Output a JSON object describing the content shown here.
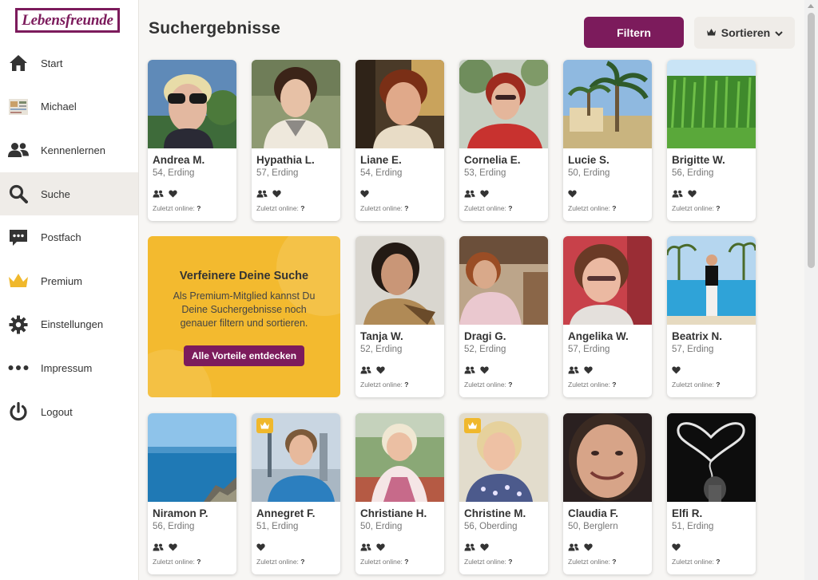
{
  "app": {
    "logo_text": "Lebensfreunde",
    "brand_color": "#7c1b5c",
    "accent_color": "#f3ba2f"
  },
  "sidebar": {
    "items": [
      {
        "id": "start",
        "label": "Start",
        "icon": "home-icon"
      },
      {
        "id": "profile",
        "label": "Michael",
        "icon": "profile-thumbnail"
      },
      {
        "id": "kennenlernen",
        "label": "Kennenlernen",
        "icon": "users-icon"
      },
      {
        "id": "suche",
        "label": "Suche",
        "icon": "search-icon",
        "active": true
      },
      {
        "id": "postfach",
        "label": "Postfach",
        "icon": "message-icon"
      },
      {
        "id": "premium",
        "label": "Premium",
        "icon": "crown-icon"
      },
      {
        "id": "einstellungen",
        "label": "Einstellungen",
        "icon": "gear-icon"
      },
      {
        "id": "impressum",
        "label": "Impressum",
        "icon": "more-dots-icon"
      },
      {
        "id": "logout",
        "label": "Logout",
        "icon": "power-icon"
      }
    ]
  },
  "header": {
    "title": "Suchergebnisse",
    "filter_label": "Filtern",
    "sort_label": "Sortieren"
  },
  "online_label": "Zuletzt online:",
  "online_value": "?",
  "promo": {
    "title": "Verfeinere Deine Suche",
    "text": "Als Premium-Mitglied kannst Du Deine Suchergebnisse noch genauer filtern und sortieren.",
    "button_label": "Alle Vorteile entdecken"
  },
  "results": [
    {
      "name": "Andrea M.",
      "meta": "54, Erding",
      "icons": [
        "group-icon",
        "heart-icon"
      ],
      "premium": false
    },
    {
      "name": "Hypathia L.",
      "meta": "57, Erding",
      "icons": [
        "group-icon",
        "heart-icon"
      ],
      "premium": false
    },
    {
      "name": "Liane E.",
      "meta": "54, Erding",
      "icons": [
        "heart-icon"
      ],
      "premium": false
    },
    {
      "name": "Cornelia E.",
      "meta": "53, Erding",
      "icons": [
        "group-icon",
        "heart-icon"
      ],
      "premium": false
    },
    {
      "name": "Lucie S.",
      "meta": "50, Erding",
      "icons": [
        "heart-icon"
      ],
      "premium": false
    },
    {
      "name": "Brigitte W.",
      "meta": "56, Erding",
      "icons": [
        "group-icon",
        "heart-icon"
      ],
      "premium": false
    },
    {
      "name": "Tanja W.",
      "meta": "52, Erding",
      "icons": [
        "group-icon",
        "heart-icon"
      ],
      "premium": false
    },
    {
      "name": "Dragi G.",
      "meta": "52, Erding",
      "icons": [
        "group-icon",
        "heart-icon"
      ],
      "premium": false
    },
    {
      "name": "Angelika W.",
      "meta": "57, Erding",
      "icons": [
        "group-icon",
        "heart-icon"
      ],
      "premium": false
    },
    {
      "name": "Beatrix N.",
      "meta": "57, Erding",
      "icons": [
        "heart-icon"
      ],
      "premium": false
    },
    {
      "name": "Niramon P.",
      "meta": "56, Erding",
      "icons": [
        "group-icon",
        "heart-icon"
      ],
      "premium": false
    },
    {
      "name": "Annegret F.",
      "meta": "51, Erding",
      "icons": [
        "heart-icon"
      ],
      "premium": true
    },
    {
      "name": "Christiane H.",
      "meta": "50, Erding",
      "icons": [
        "group-icon",
        "heart-icon"
      ],
      "premium": false
    },
    {
      "name": "Christine M.",
      "meta": "56, Oberding",
      "icons": [
        "group-icon",
        "heart-icon"
      ],
      "premium": true
    },
    {
      "name": "Claudia F.",
      "meta": "50, Berglern",
      "icons": [
        "group-icon",
        "heart-icon"
      ],
      "premium": false
    },
    {
      "name": "Elfi R.",
      "meta": "51, Erding",
      "icons": [
        "heart-icon"
      ],
      "premium": false
    }
  ]
}
